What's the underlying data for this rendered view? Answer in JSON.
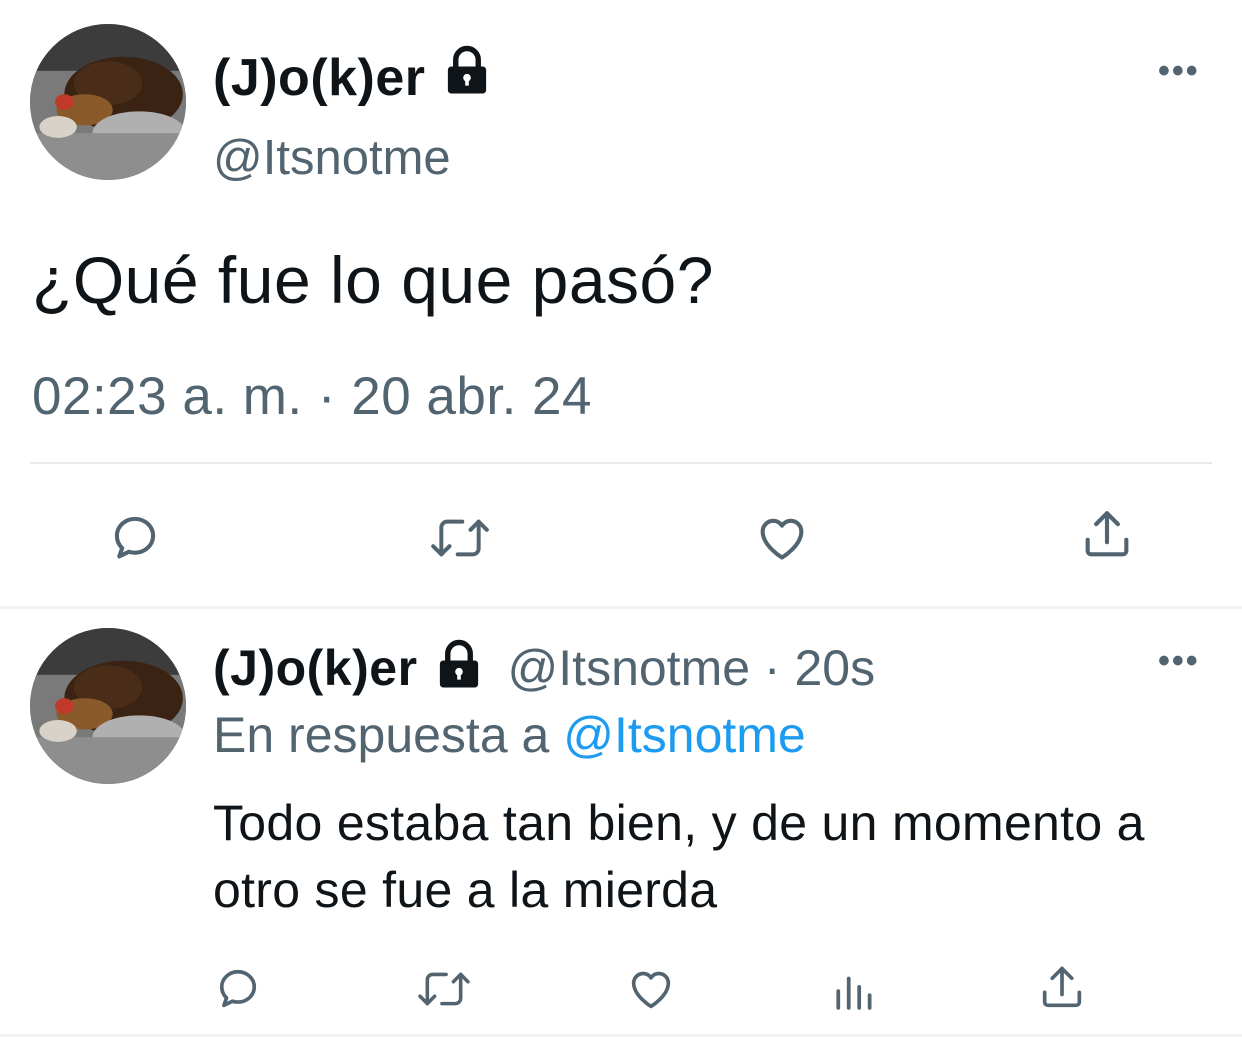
{
  "main_tweet": {
    "display_name": "(J)o(k)er",
    "handle": "@Itsnotme",
    "text": "¿Qué fue lo que pasó?",
    "timestamp": "02:23 a. m. · 20 abr. 24",
    "more_label": "•••",
    "icons": [
      "reply-icon",
      "retweet-icon",
      "like-icon",
      "share-icon"
    ]
  },
  "reply_tweet": {
    "display_name": "(J)o(k)er",
    "handle_time": "@Itsnotme · 20s",
    "reply_prefix": "En respuesta a",
    "reply_mention": "@Itsnotme",
    "text": "Todo estaba tan bien, y de un momento a otro se fue a la mierda",
    "more_label": "•••",
    "icons": [
      "reply-icon",
      "retweet-icon",
      "like-icon",
      "views-icon",
      "share-icon"
    ]
  },
  "colors": {
    "text": "#0f1419",
    "secondary": "#536471",
    "link": "#1d9bf0",
    "divider": "#e7e9ea"
  }
}
